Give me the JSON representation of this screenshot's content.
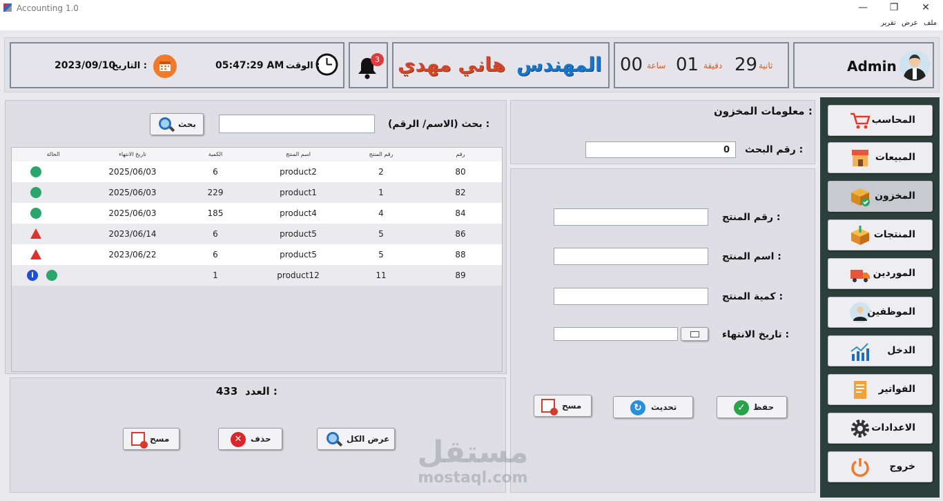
{
  "window": {
    "title": "Accounting 1.0",
    "minimize": "—",
    "maximize": "❐",
    "close": "✕"
  },
  "menu": [
    "ملف",
    "عرض",
    "تقرير"
  ],
  "header": {
    "user": "Admin",
    "timer": {
      "seconds": "29",
      "seconds_label": "ثانية",
      "minutes": "01",
      "minutes_label": "دقيقة",
      "hours": "00",
      "hours_label": "ساعة"
    },
    "engineer_title": "المهندس",
    "engineer_name": "هاني مهدي",
    "notifications": "3",
    "time_label": "الوقت :",
    "time_value": "05:47:29 AM",
    "date_label": "التاريخ :",
    "date_value": "2023/09/10"
  },
  "sidebar": [
    {
      "label": "المحاسب",
      "icon": "cart-icon"
    },
    {
      "label": "المبيعات",
      "icon": "shop-icon"
    },
    {
      "label": "المخزون",
      "icon": "inventory-box-icon"
    },
    {
      "label": "المنتجات",
      "icon": "products-box-icon"
    },
    {
      "label": "الموردين",
      "icon": "truck-icon"
    },
    {
      "label": "الموظفين",
      "icon": "employee-icon"
    },
    {
      "label": "الدخل",
      "icon": "income-chart-icon"
    },
    {
      "label": "الفواتير",
      "icon": "invoice-icon"
    },
    {
      "label": "الاعدادات",
      "icon": "gear-icon"
    },
    {
      "label": "خروج",
      "icon": "power-icon"
    }
  ],
  "inventory": {
    "title": "معلومات المخزون :",
    "search_no_label": "رقم البحث :",
    "search_no_value": "0",
    "fields": {
      "product_no": "رقم المنتج :",
      "product_name": "اسم المنتج :",
      "quantity": "كمية المنتج :",
      "expiry": "تاريخ الانتهاء :"
    },
    "buttons": {
      "save": "حفظ",
      "update": "تحديث",
      "clear": "مسح"
    }
  },
  "search": {
    "label": "بحث (الاسم/ الرقم) :",
    "button": "بحث",
    "value": ""
  },
  "table": {
    "columns": [
      "رقم",
      "رقم المنتج",
      "اسم المنتج",
      "الكمية",
      "تاريخ الانتهاء",
      "الحالة"
    ],
    "rows": [
      {
        "id": "80",
        "pno": "2",
        "name": "product2",
        "qty": "6",
        "exp": "2025/06/03",
        "status": "ok"
      },
      {
        "id": "82",
        "pno": "1",
        "name": "product1",
        "qty": "229",
        "exp": "2025/06/03",
        "status": "ok"
      },
      {
        "id": "84",
        "pno": "4",
        "name": "product4",
        "qty": "185",
        "exp": "2025/06/03",
        "status": "ok"
      },
      {
        "id": "86",
        "pno": "5",
        "name": "product5",
        "qty": "6",
        "exp": "2023/06/14",
        "status": "warn"
      },
      {
        "id": "88",
        "pno": "5",
        "name": "product5",
        "qty": "6",
        "exp": "2023/06/22",
        "status": "warn"
      },
      {
        "id": "89",
        "pno": "11",
        "name": "product12",
        "qty": "1",
        "exp": "",
        "status": "ok-info"
      }
    ]
  },
  "footer": {
    "count_label": "العدد :",
    "count_value": "433",
    "buttons": {
      "show_all": "عرض الكل",
      "delete": "حذف",
      "clear": "مسح"
    }
  },
  "watermark": {
    "ar": "مستقل",
    "en": "mostaql.com"
  },
  "colors": {
    "sidebar": "#2d3f3a",
    "accent_orange": "#f07a2a",
    "ok": "#2aa56b",
    "warn": "#e0322d"
  }
}
